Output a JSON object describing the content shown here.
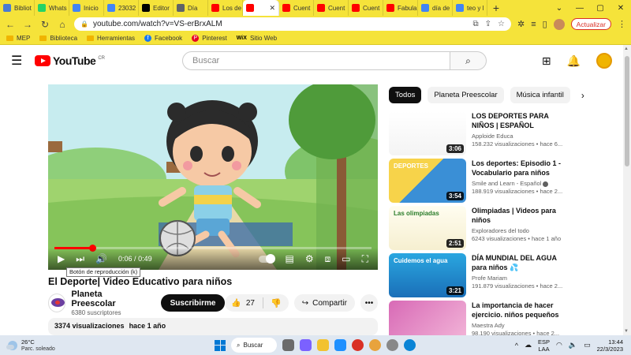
{
  "browser": {
    "tabs": [
      {
        "label": "Bibliot",
        "color": "#4a7bd1"
      },
      {
        "label": "Whats",
        "color": "#25d366"
      },
      {
        "label": "Inicio",
        "color": "#4285f4"
      },
      {
        "label": "23032",
        "color": "#4285f4"
      },
      {
        "label": "Editor",
        "color": "#000000"
      },
      {
        "label": "Día",
        "color": "#5f6368"
      },
      {
        "label": "Los de",
        "color": "#ff0000"
      },
      {
        "label": "",
        "color": "#ff0000",
        "active": true
      },
      {
        "label": "Cuent",
        "color": "#ff0000"
      },
      {
        "label": "Cuent",
        "color": "#ff0000"
      },
      {
        "label": "Cuent",
        "color": "#ff0000"
      },
      {
        "label": "Fabula",
        "color": "#ff0000"
      },
      {
        "label": "día de",
        "color": "#4285f4"
      },
      {
        "label": "teo y l",
        "color": "#4285f4"
      }
    ],
    "new_tab": "+",
    "url": "youtube.com/watch?v=VS-erBrxALM",
    "update_label": "Actualizar",
    "bookmarks": [
      {
        "label": "MEP",
        "icon": "folder-icon"
      },
      {
        "label": "Biblioteca",
        "icon": "folder-icon"
      },
      {
        "label": "Herramientas",
        "icon": "folder-icon"
      },
      {
        "label": "Facebook",
        "icon": "facebook-icon"
      },
      {
        "label": "Pinterest",
        "icon": "pinterest-icon"
      },
      {
        "label": "Sitio Web",
        "icon": "wix-icon"
      }
    ]
  },
  "youtube": {
    "logo_text": "YouTube",
    "country": "CR",
    "search_placeholder": "Buscar",
    "video": {
      "title": "El Deporte| Video Educativo para niños",
      "time_current": "0:06",
      "time_total": "0:49",
      "progress": 0.12,
      "tooltip": "Botón de reproducción (k)"
    },
    "channel": {
      "name": "Planeta Preescolar",
      "subscribers": "6380 suscriptores",
      "subscribe_label": "Suscribirme"
    },
    "actions": {
      "likes": "27",
      "share_label": "Compartir"
    },
    "description": {
      "views": "3374 visualizaciones",
      "age": "hace 1 año"
    },
    "chips": [
      "Todos",
      "Planeta Preescolar",
      "Música infantil"
    ],
    "recommendations": [
      {
        "title": "LOS DEPORTES PARA NIÑOS | ESPAÑOL",
        "channel": "Apploide Educa",
        "views": "158.232 visualizaciones",
        "age": "hace 6...",
        "duration": "3:06",
        "verified": false
      },
      {
        "title": "Los deportes: Episodio 1 - Vocabulario para niños",
        "channel": "Smile and Learn - Español",
        "views": "188.919 visualizaciones",
        "age": "hace 2...",
        "duration": "3:54",
        "verified": true,
        "thumb_label": "DEPORTES"
      },
      {
        "title": "Olimpiadas | Videos para niños",
        "channel": "Exploradores del todo",
        "views": "6243 visualizaciones",
        "age": "hace 1 año",
        "duration": "2:51",
        "verified": false,
        "thumb_label": "Las olimpiadas"
      },
      {
        "title": "DÍA MUNDIAL DEL AGUA para niños 💦",
        "channel": "Profe Mariam",
        "views": "191.879 visualizaciones",
        "age": "hace 2...",
        "duration": "3:21",
        "verified": false,
        "thumb_label": "Cuidemos el agua"
      },
      {
        "title": "La importancia de hacer ejercicio. niños pequeños",
        "channel": "Maestra Ady",
        "views": "98.190 visualizaciones",
        "age": "hace 2...",
        "duration": "",
        "verified": false
      }
    ]
  },
  "taskbar": {
    "temperature": "26°C",
    "condition": "Parc. soleado",
    "search_label": "Buscar",
    "lang_top": "ESP",
    "lang_bottom": "LAA",
    "time": "13:44",
    "date": "22/3/2023"
  },
  "colors": {
    "browser_theme": "#f5e33a",
    "yt_red": "#ff0000",
    "subscribe_bg": "#0f0f0f"
  }
}
